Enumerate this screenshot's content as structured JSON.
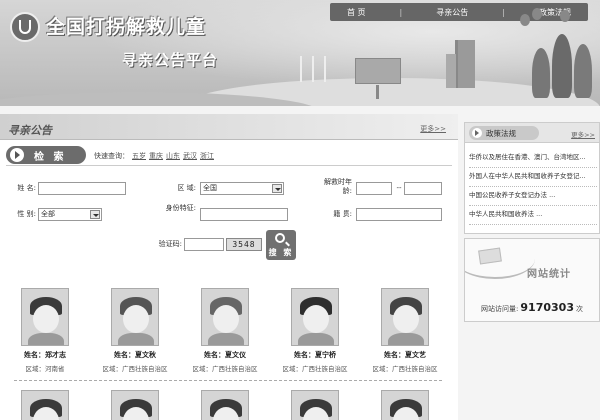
{
  "header": {
    "site_title": "全国打拐解救儿童",
    "site_subtitle": "寻亲公告平台",
    "nav": [
      {
        "label": "首 页"
      },
      {
        "label": "寻亲公告"
      },
      {
        "label": "政策法规"
      }
    ]
  },
  "notice": {
    "section_title": "寻亲公告",
    "more_label": "更多>>",
    "search_label": "检 索",
    "quick_label": "快速查询：",
    "quick_links": [
      "五岁",
      "重庆",
      "山东",
      "武汉",
      "浙江"
    ]
  },
  "form": {
    "name_label": "姓  名:",
    "name_value": "",
    "region_label": "区  域:",
    "region_value": "全国",
    "rescue_time_label": "解救时年龄:",
    "rescue_from": "",
    "rescue_sep": "--",
    "rescue_to": "",
    "gender_label": "性  别:",
    "gender_value": "全部",
    "id_label": "身份特征:",
    "id_value": "",
    "hometown_label": "籍  贯:",
    "hometown_value": "",
    "captcha_label": "验证码:",
    "captcha_input": "",
    "captcha_code": "3548",
    "search_button": "搜 索"
  },
  "children": [
    {
      "name": "姓名：郑才志",
      "region": "区域：河南省"
    },
    {
      "name": "姓名：夏文秋",
      "region": "区域：广西壮族自治区"
    },
    {
      "name": "姓名：夏文仪",
      "region": "区域：广西壮族自治区"
    },
    {
      "name": "姓名：夏宁桥",
      "region": "区域：广西壮族自治区"
    },
    {
      "name": "姓名：夏文艺",
      "region": "区域：广西壮族自治区"
    }
  ],
  "policy": {
    "title": "政策法规",
    "more_label": "更多>>",
    "items": [
      "华侨以及居住在香港、澳门、台湾地区...",
      "外国人在中华人民共和国收养子女登记...",
      "中国公民收养子女登记办法 ...",
      "中华人民共和国收养法 ..."
    ]
  },
  "stats": {
    "title": "网站统计",
    "visits_label": "网站访问量:",
    "visits_value": "9170303",
    "visits_unit": "次"
  }
}
